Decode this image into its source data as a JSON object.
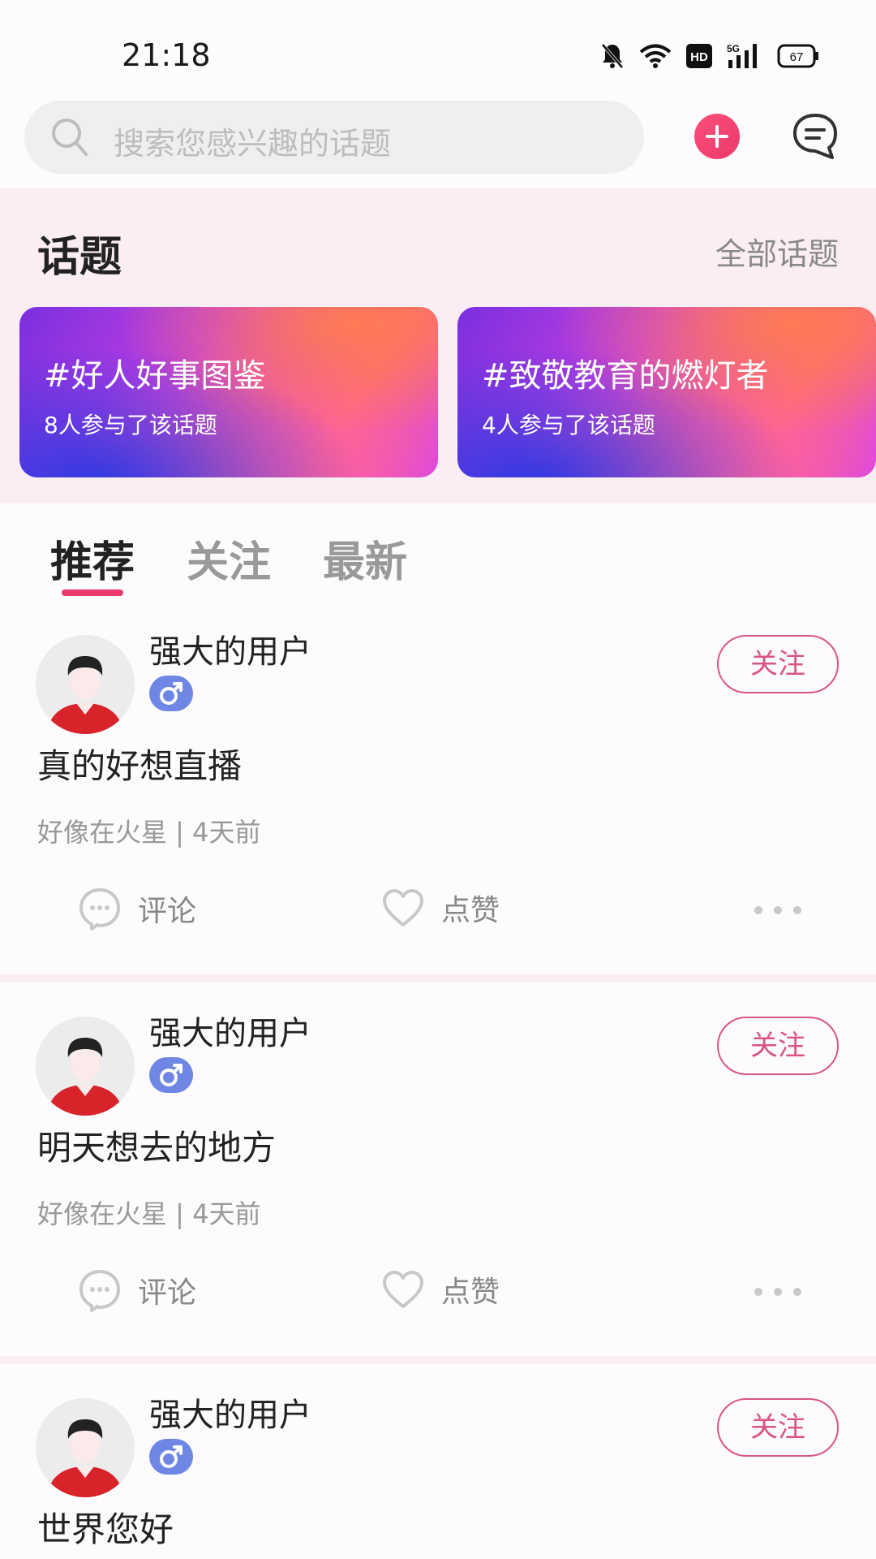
{
  "status_bar": {
    "time": "21:18",
    "battery": "67",
    "network": "5G",
    "hd": "HD"
  },
  "search": {
    "placeholder": "搜索您感兴趣的话题"
  },
  "topics": {
    "title": "话题",
    "all_label": "全部话题",
    "cards": [
      {
        "name": "#好人好事图鉴",
        "count": "8人参与了该话题"
      },
      {
        "name": "#致敬教育的燃灯者",
        "count": "4人参与了该话题"
      }
    ]
  },
  "tabs": [
    {
      "label": "推荐",
      "active": true
    },
    {
      "label": "关注",
      "active": false
    },
    {
      "label": "最新",
      "active": false
    }
  ],
  "posts": [
    {
      "username": "强大的用户",
      "gender": "♂",
      "follow_label": "关注",
      "text": "真的好想直播",
      "meta": "好像在火星 | 4天前",
      "comment_label": "评论",
      "like_label": "点赞"
    },
    {
      "username": "强大的用户",
      "gender": "♂",
      "follow_label": "关注",
      "text": "明天想去的地方",
      "meta": "好像在火星 | 4天前",
      "comment_label": "评论",
      "like_label": "点赞"
    },
    {
      "username": "强大的用户",
      "gender": "♂",
      "follow_label": "关注",
      "text": "世界您好",
      "meta": "",
      "comment_label": "",
      "like_label": ""
    }
  ],
  "colors": {
    "accent": "#e8396a",
    "follow": "#d9557f",
    "gender_male": "#6e86e4",
    "section_bg": "#faeef4"
  }
}
